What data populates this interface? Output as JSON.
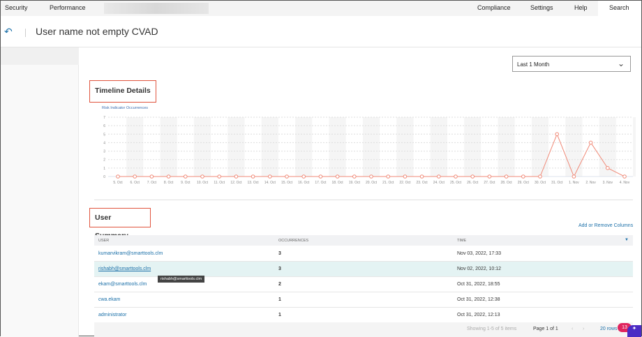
{
  "nav": {
    "left": [
      "Security",
      "Performance"
    ],
    "right": [
      "Compliance",
      "Settings",
      "Help",
      "Search"
    ]
  },
  "header": {
    "title": "User name not empty CVAD"
  },
  "filter": {
    "selected": "Last 1 Month"
  },
  "timeline": {
    "heading": "Timeline Details"
  },
  "chart_data": {
    "type": "line",
    "title": "",
    "ylabel": "Risk Indicator Occurrences",
    "xlabel": "",
    "ylim": [
      0,
      7
    ],
    "yticks": [
      0,
      1,
      2,
      3,
      4,
      5,
      6,
      7
    ],
    "grid": true,
    "color": "#f08a78",
    "x": [
      "5. Oct",
      "6. Oct",
      "7. Oct",
      "8. Oct",
      "9. Oct",
      "10. Oct",
      "11. Oct",
      "12. Oct",
      "13. Oct",
      "14. Oct",
      "15. Oct",
      "16. Oct",
      "17. Oct",
      "18. Oct",
      "19. Oct",
      "20. Oct",
      "21. Oct",
      "22. Oct",
      "23. Oct",
      "24. Oct",
      "25. Oct",
      "26. Oct",
      "27. Oct",
      "28. Oct",
      "29. Oct",
      "30. Oct",
      "31. Oct",
      "1. Nov",
      "2. Nov",
      "3. Nov",
      "4. Nov"
    ],
    "values": [
      0,
      0,
      0,
      0,
      0,
      0,
      0,
      0,
      0,
      0,
      0,
      0,
      0,
      0,
      0,
      0,
      0,
      0,
      0,
      0,
      0,
      0,
      0,
      0,
      0,
      0,
      5,
      0,
      4,
      1,
      0
    ]
  },
  "summary": {
    "heading": "User Summary",
    "add_columns": "Add or Remove Columns",
    "columns": [
      "USER",
      "OCCURRENCES",
      "TIME"
    ],
    "rows": [
      {
        "user": "kumarvikram@smarttools.clm",
        "occ": "3",
        "time": "Nov 03, 2022, 17:33"
      },
      {
        "user": "rishabh@smarttools.clm",
        "occ": "3",
        "time": "Nov 02, 2022, 10:12"
      },
      {
        "user": "ekam@smarttools.clm",
        "occ": "2",
        "time": "Oct 31, 2022, 18:55"
      },
      {
        "user": "cwa.ekam",
        "occ": "1",
        "time": "Oct 31, 2022, 12:38"
      },
      {
        "user": "administrator",
        "occ": "1",
        "time": "Oct 31, 2022, 12:13"
      }
    ],
    "tooltip": "rishabh@smarttools.clm",
    "pager": {
      "showing": "Showing 1-5 of 5 items",
      "page": "Page 1 of 1",
      "rows": "20 rows"
    }
  },
  "notifications": {
    "count": "13"
  }
}
